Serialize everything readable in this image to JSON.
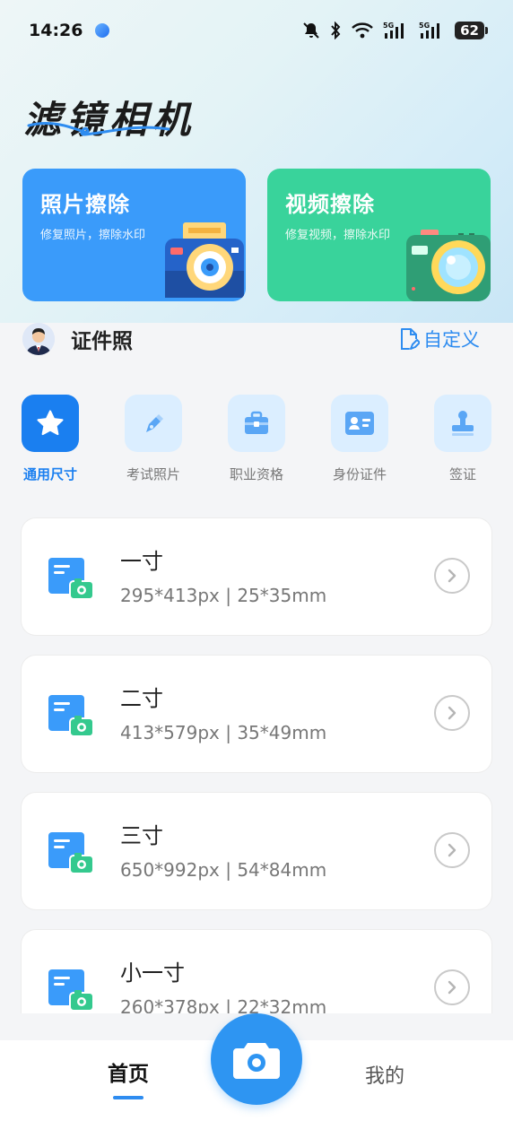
{
  "status_bar": {
    "time": "14:26",
    "battery": "62"
  },
  "header": {
    "app_title": "滤镜相机"
  },
  "cards": [
    {
      "title": "照片擦除",
      "subtitle": "修复照片，擦除水印",
      "color": "#3a9bfa"
    },
    {
      "title": "视频擦除",
      "subtitle": "修复视频，擦除水印",
      "color": "#39d39b"
    }
  ],
  "id_photo": {
    "title": "证件照",
    "custom_label": "自定义"
  },
  "categories": [
    {
      "label": "通用尺寸",
      "icon": "star-icon",
      "active": true
    },
    {
      "label": "考试照片",
      "icon": "pen-icon",
      "active": false
    },
    {
      "label": "职业资格",
      "icon": "briefcase-icon",
      "active": false
    },
    {
      "label": "身份证件",
      "icon": "id-card-icon",
      "active": false
    },
    {
      "label": "签证",
      "icon": "stamp-icon",
      "active": false
    }
  ],
  "sizes": [
    {
      "name": "一寸",
      "spec": "295*413px | 25*35mm"
    },
    {
      "name": "二寸",
      "spec": "413*579px | 35*49mm"
    },
    {
      "name": "三寸",
      "spec": "650*992px | 54*84mm"
    },
    {
      "name": "小一寸",
      "spec": "260*378px | 22*32mm"
    }
  ],
  "tabbar": {
    "home": "首页",
    "mine": "我的"
  },
  "colors": {
    "accent": "#2e8cf0",
    "active_category": "#1a7ff0"
  }
}
